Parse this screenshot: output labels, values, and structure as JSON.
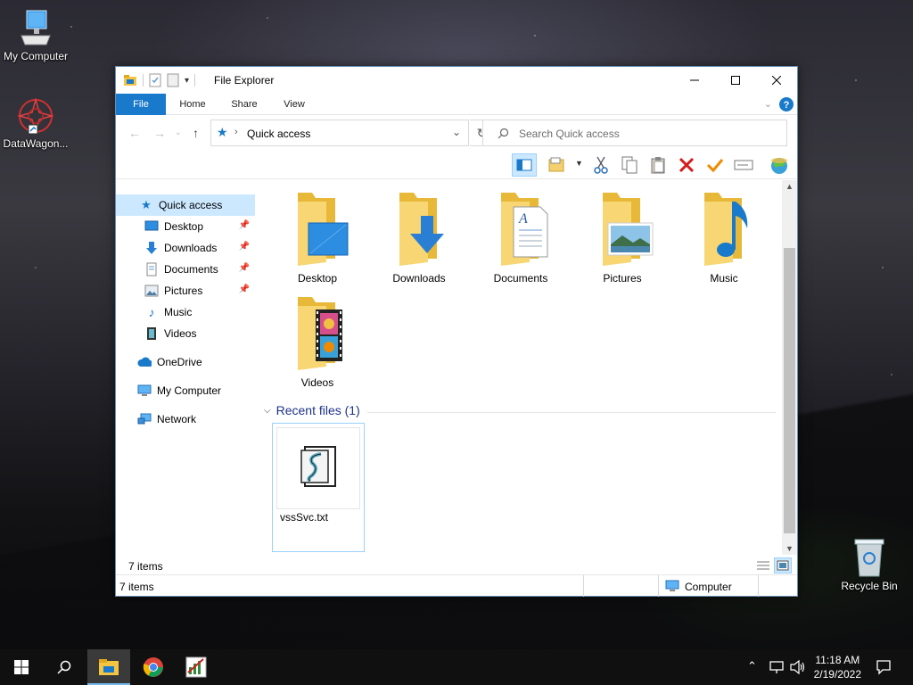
{
  "desktop": {
    "icons": [
      {
        "label": "My Computer"
      },
      {
        "label": "DataWagon..."
      },
      {
        "label": "Recycle Bin"
      }
    ]
  },
  "window": {
    "title": "File Explorer",
    "ribbon_tabs": [
      {
        "label": "File"
      },
      {
        "label": "Home"
      },
      {
        "label": "Share"
      },
      {
        "label": "View"
      }
    ],
    "address": {
      "value": "Quick access"
    },
    "search": {
      "placeholder": "Search Quick access"
    },
    "toolbar_icons": [
      "layout-pane-icon",
      "properties-icon",
      "cut-icon",
      "copy-icon",
      "paste-icon",
      "delete-icon",
      "check-icon",
      "rename-icon",
      "world-icon"
    ]
  },
  "navpane": {
    "items": [
      {
        "label": "Quick access",
        "icon": "star-icon"
      },
      {
        "label": "Desktop",
        "icon": "desktop-icon",
        "pinned": true
      },
      {
        "label": "Downloads",
        "icon": "download-icon",
        "pinned": true
      },
      {
        "label": "Documents",
        "icon": "document-icon",
        "pinned": true
      },
      {
        "label": "Pictures",
        "icon": "picture-icon",
        "pinned": true
      },
      {
        "label": "Music",
        "icon": "music-icon"
      },
      {
        "label": "Videos",
        "icon": "video-icon"
      },
      {
        "label": "OneDrive",
        "icon": "cloud-icon"
      },
      {
        "label": "My Computer",
        "icon": "computer-icon"
      },
      {
        "label": "Network",
        "icon": "network-icon"
      }
    ]
  },
  "content": {
    "folders": [
      {
        "label": "Desktop"
      },
      {
        "label": "Downloads"
      },
      {
        "label": "Documents"
      },
      {
        "label": "Pictures"
      },
      {
        "label": "Music"
      },
      {
        "label": "Videos"
      }
    ],
    "recent_header": "Recent files (1)",
    "recent_files": [
      {
        "label": "vssSvc.txt"
      }
    ]
  },
  "status": {
    "item_count_inner": "7 items",
    "item_count": "7 items",
    "location": "Computer"
  },
  "taskbar": {
    "time": "11:18 AM",
    "date": "2/19/2022"
  },
  "colors": {
    "accent": "#1979ca",
    "selection": "#cce8ff",
    "section_header": "#1e3287"
  }
}
